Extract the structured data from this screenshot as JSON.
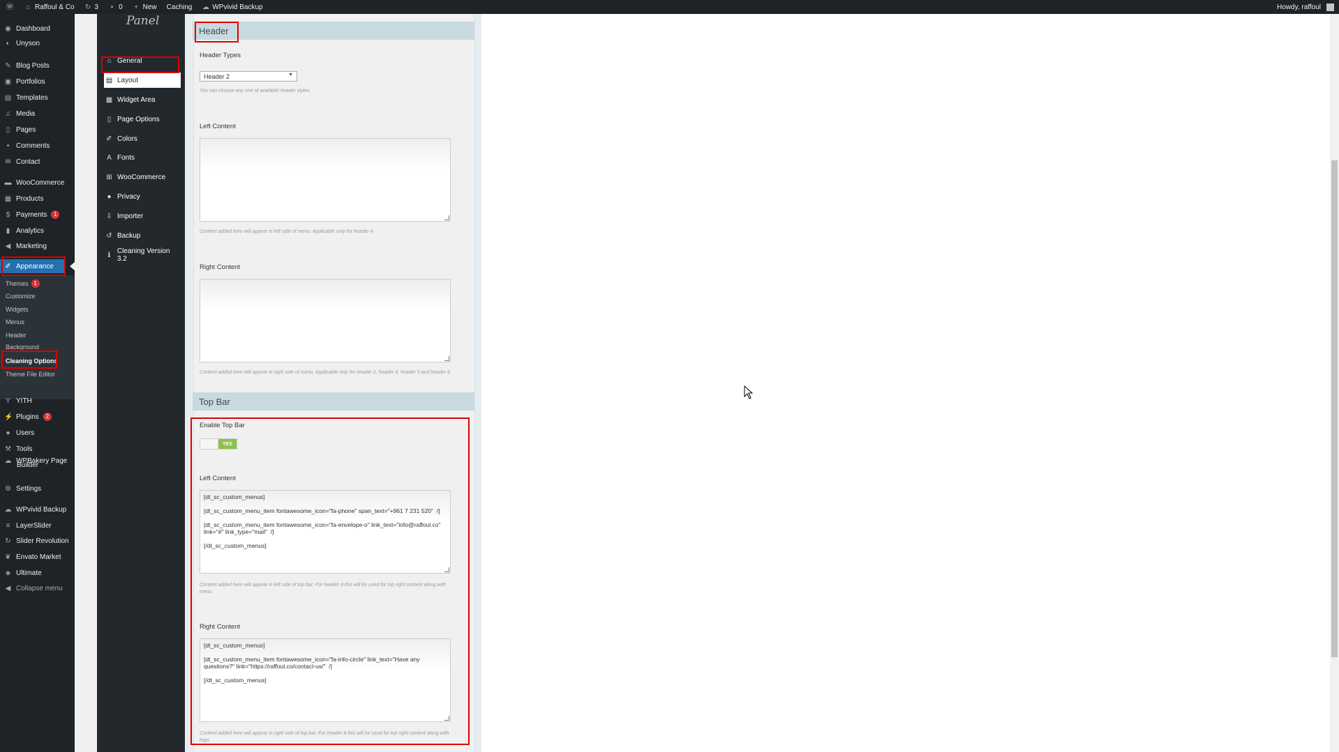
{
  "adminbar": {
    "site_name": "Raffoul & Co",
    "updates_count": "3",
    "comments_count": "0",
    "new_label": "New",
    "caching_label": "Caching",
    "backup_label": "WPvivid Backup",
    "howdy": "Howdy, raffoul"
  },
  "menu": {
    "dashboard": "Dashboard",
    "unyson": "Unyson",
    "blog_posts": "Blog Posts",
    "portfolios": "Portfolios",
    "templates": "Templates",
    "media": "Media",
    "pages": "Pages",
    "comments": "Comments",
    "contact": "Contact",
    "woocommerce": "WooCommerce",
    "products": "Products",
    "payments": "Payments",
    "payments_badge": "1",
    "analytics": "Analytics",
    "marketing": "Marketing",
    "appearance": "Appearance",
    "themes": "Themes",
    "themes_badge": "1",
    "customize": "Customize",
    "widgets": "Widgets",
    "menus": "Menus",
    "header": "Header",
    "background": "Background",
    "cleaning_options": "Cleaning Options",
    "theme_file_editor": "Theme File Editor",
    "yith": "YITH",
    "plugins": "Plugins",
    "plugins_badge": "2",
    "users": "Users",
    "tools": "Tools",
    "wpbakery": "WPBakery Page",
    "wpbakery2": "Builder",
    "settings": "Settings",
    "wpvivid": "WPvivid Backup",
    "layerslider": "LayerSlider",
    "slider_revolution": "Slider Revolution",
    "envato": "Envato Market",
    "ultimate": "Ultimate",
    "collapse": "Collapse menu"
  },
  "panel": {
    "title": "Panel",
    "nav": {
      "general": "General",
      "layout": "Layout",
      "widget_area": "Widget Area",
      "page_options": "Page Options",
      "colors": "Colors",
      "fonts": "Fonts",
      "woocommerce": "WooCommerce",
      "privacy": "Privacy",
      "importer": "Importer",
      "backup": "Backup",
      "version": "Cleaning Version 3.2"
    }
  },
  "header_section": {
    "title": "Header",
    "header_types_label": "Header Types",
    "header_types_value": "Header 2",
    "header_types_desc": "You can choose any one of available header styles.",
    "left_content_label": "Left Content",
    "left_content_desc": "Content added here will appear in left side of menu. Applicable only for header 4.",
    "right_content_label": "Right Content",
    "right_content_desc": "Content added here will appear in right side of menu. Applicable only for header 2, header 4, header 5 and header 6."
  },
  "topbar_section": {
    "title": "Top Bar",
    "enable_label": "Enable Top Bar",
    "toggle_on": "YES",
    "left_content_label": "Left Content",
    "left_content_value": "[dt_sc_custom_menus]\n\n[dt_sc_custom_menu_item fontawesome_icon=\"fa-phone\" span_text=\"+961 7 231 520\"  /]\n\n[dt_sc_custom_menu_item fontawesome_icon=\"fa-envelope-o\" link_text=\"info@raffoul.co\" link=\"#\" link_type=\"mail\"  /]\n\n[/dt_sc_custom_menus]",
    "left_content_desc": "Content added here will appear in left side of top bar. For header 8 this will be used for top right content along with menu.",
    "right_content_label": "Right Content",
    "right_content_value": "[dt_sc_custom_menus]\n\n[dt_sc_custom_menu_item fontawesome_icon=\"fa-info-circle\" link_text=\"Have any questions?\" link=\"https://raffoul.co/contact-us/\"  /]\n\n[/dt_sc_custom_menus]",
    "right_content_desc": "Content added here will appear in right side of top bar. For header 8 this will be used for top right content along with logo."
  },
  "colors": {
    "adminbar_bg": "#1d2327",
    "menu_current": "#2271b1",
    "section_bar": "#c8d9e0",
    "toggle_on": "#8bc34a",
    "highlight": "#e00000"
  },
  "icons": [
    "wordpress-logo-icon",
    "home-icon",
    "refresh-icon",
    "comment-icon",
    "plus-icon",
    "cloud-icon",
    "user-avatar-icon",
    "mouse-cursor-icon"
  ]
}
